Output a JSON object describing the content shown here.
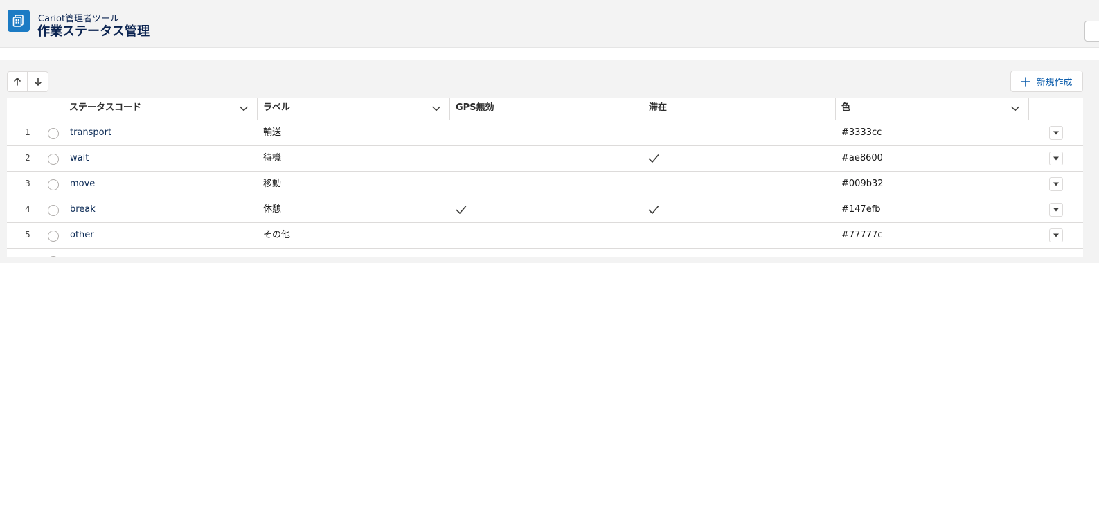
{
  "header": {
    "app_subtitle": "Cariot管理者ツール",
    "page_title": "作業ステータス管理"
  },
  "toolbar": {
    "new_label": "新規作成"
  },
  "table": {
    "columns": {
      "code": "ステータスコード",
      "label": "ラベル",
      "gps": "GPS無効",
      "stay": "滞在",
      "color": "色"
    },
    "rows": [
      {
        "num": "1",
        "code": "transport",
        "label": "輸送",
        "gps": false,
        "stay": false,
        "color": "#3333cc"
      },
      {
        "num": "2",
        "code": "wait",
        "label": "待機",
        "gps": false,
        "stay": true,
        "color": "#ae8600"
      },
      {
        "num": "3",
        "code": "move",
        "label": "移動",
        "gps": false,
        "stay": false,
        "color": "#009b32"
      },
      {
        "num": "4",
        "code": "break",
        "label": "休憩",
        "gps": true,
        "stay": true,
        "color": "#147efb"
      },
      {
        "num": "5",
        "code": "other",
        "label": "その他",
        "gps": false,
        "stay": false,
        "color": "#77777c"
      }
    ]
  },
  "icons": {
    "app": "app-grid-icon",
    "sort_up": "arrow-up-icon",
    "sort_down": "arrow-down-icon",
    "add": "plus-icon",
    "column_menu": "chevron-down-icon",
    "checked": "check-icon",
    "row_menu": "caret-down-icon"
  },
  "colors": {
    "brand": "#1b7bc4",
    "header_bg": "#f3f3f3",
    "link": "#0b5cab",
    "title": "#0a2350"
  }
}
